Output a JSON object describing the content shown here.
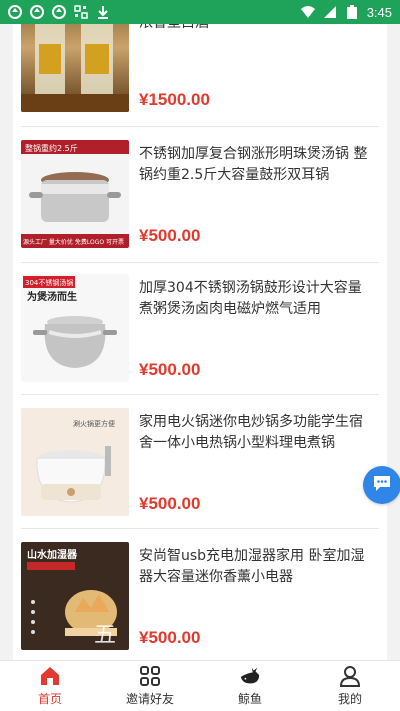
{
  "status_bar": {
    "time": "3:45"
  },
  "products": [
    {
      "title": "浓香型白酒",
      "price": "¥1500.00",
      "title_top_line": "…",
      "image": "liquor-bottles-image"
    },
    {
      "title": "不锈钢加厚复合钢涨形明珠煲汤锅 整锅约重2.5斤大容量鼓形双耳锅",
      "price": "¥500.00",
      "image": "stainless-pot-image",
      "badge": "整锅重约2.5斤",
      "banner": "源头工厂 量大价优 免费LOGO 可开票"
    },
    {
      "title": "加厚304不锈钢汤锅鼓形设计大容量 煮粥煲汤卤肉电磁炉燃气适用",
      "price": "¥500.00",
      "image": "soup-pot-image",
      "badge": "304不锈钢汤锅",
      "banner_title": "为煲汤而生"
    },
    {
      "title": "家用电火锅迷你电炒锅多功能学生宿 舍一体小电热锅小型料理电煮锅",
      "price": "¥500.00",
      "image": "electric-pot-image",
      "caption": "涮火锅更方便"
    },
    {
      "title": "安尚智usb充电加湿器家用 卧室加湿 器大容量迷你香薰小电器",
      "price": "¥500.00",
      "image": "humidifier-image",
      "caption": "山水加湿器"
    }
  ],
  "watermark": "五",
  "tabbar": {
    "tabs": [
      {
        "label": "首页",
        "icon": "home-icon",
        "active": true
      },
      {
        "label": "邀请好友",
        "icon": "grid-icon",
        "active": false
      },
      {
        "label": "鲸鱼",
        "icon": "whale-icon",
        "active": false
      },
      {
        "label": "我的",
        "icon": "person-icon",
        "active": false
      }
    ]
  },
  "colors": {
    "status_bar": "#1fa25a",
    "price": "#e23a2e",
    "active_tab": "#e23a2e",
    "fab": "#2f86e6"
  }
}
